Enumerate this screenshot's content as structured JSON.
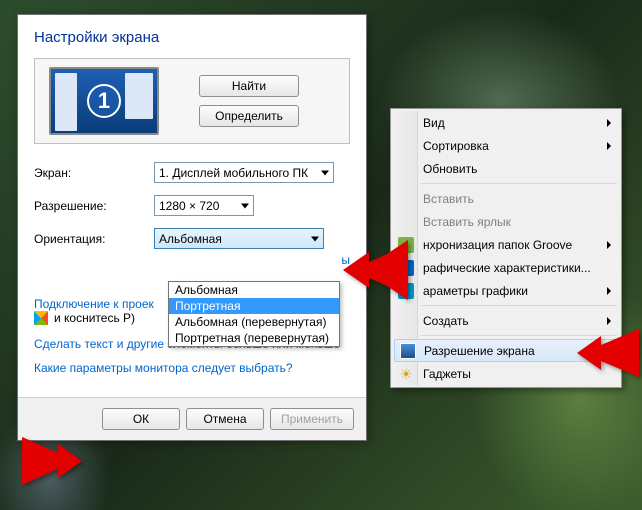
{
  "dialog": {
    "title": "Настройки экрана",
    "monitor_number": "1",
    "find_btn": "Найти",
    "detect_btn": "Определить",
    "labels": {
      "display": "Экран:",
      "resolution": "Разрешение:",
      "orientation": "Ориентация:"
    },
    "display_value": "1. Дисплей мобильного ПК",
    "resolution_value": "1280 × 720",
    "orientation_value": "Альбомная",
    "orientation_options": [
      "Альбомная",
      "Портретная",
      "Альбомная (перевернутая)",
      "Портретная (перевернутая)"
    ],
    "hidden_suffix": "ы",
    "link_connect": "Подключение к проек",
    "flag_text": "и коснитесь P)",
    "link_textsize": "Сделать текст и другие элементы больше или меньше",
    "link_which": "Какие параметры монитора следует выбрать?",
    "ok": "ОК",
    "cancel": "Отмена",
    "apply": "Применить"
  },
  "ctx": {
    "view": "Вид",
    "sort": "Сортировка",
    "refresh": "Обновить",
    "paste": "Вставить",
    "paste_shortcut": "Вставить ярлык",
    "groove": "нхронизация папок Groove",
    "gfx_char": "рафические характеристики...",
    "gfx_params": "араметры графики",
    "create": "Создать",
    "resolution": "Разрешение экрана",
    "gadgets": "Гаджеты"
  }
}
